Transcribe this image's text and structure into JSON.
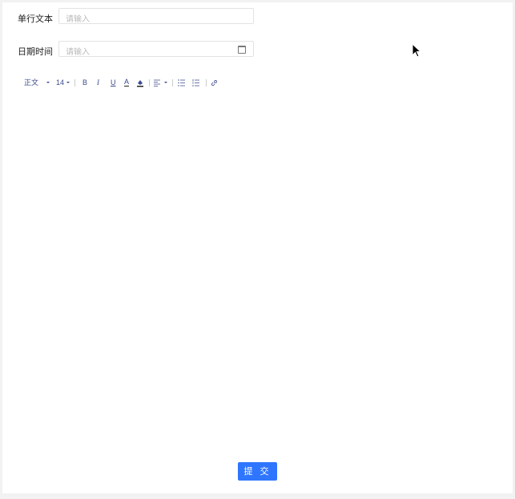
{
  "form": {
    "text_field": {
      "label": "单行文本",
      "placeholder": "请输入"
    },
    "datetime_field": {
      "label": "日期时间",
      "placeholder": "请输入"
    }
  },
  "toolbar": {
    "paragraph": "正文",
    "font_size": "14",
    "bold": "B",
    "italic": "I",
    "underline": "U",
    "font_color": "A"
  },
  "submit_label": "提 交",
  "colors": {
    "accent": "#2f76ff",
    "toolbar": "#3a4a8c"
  }
}
